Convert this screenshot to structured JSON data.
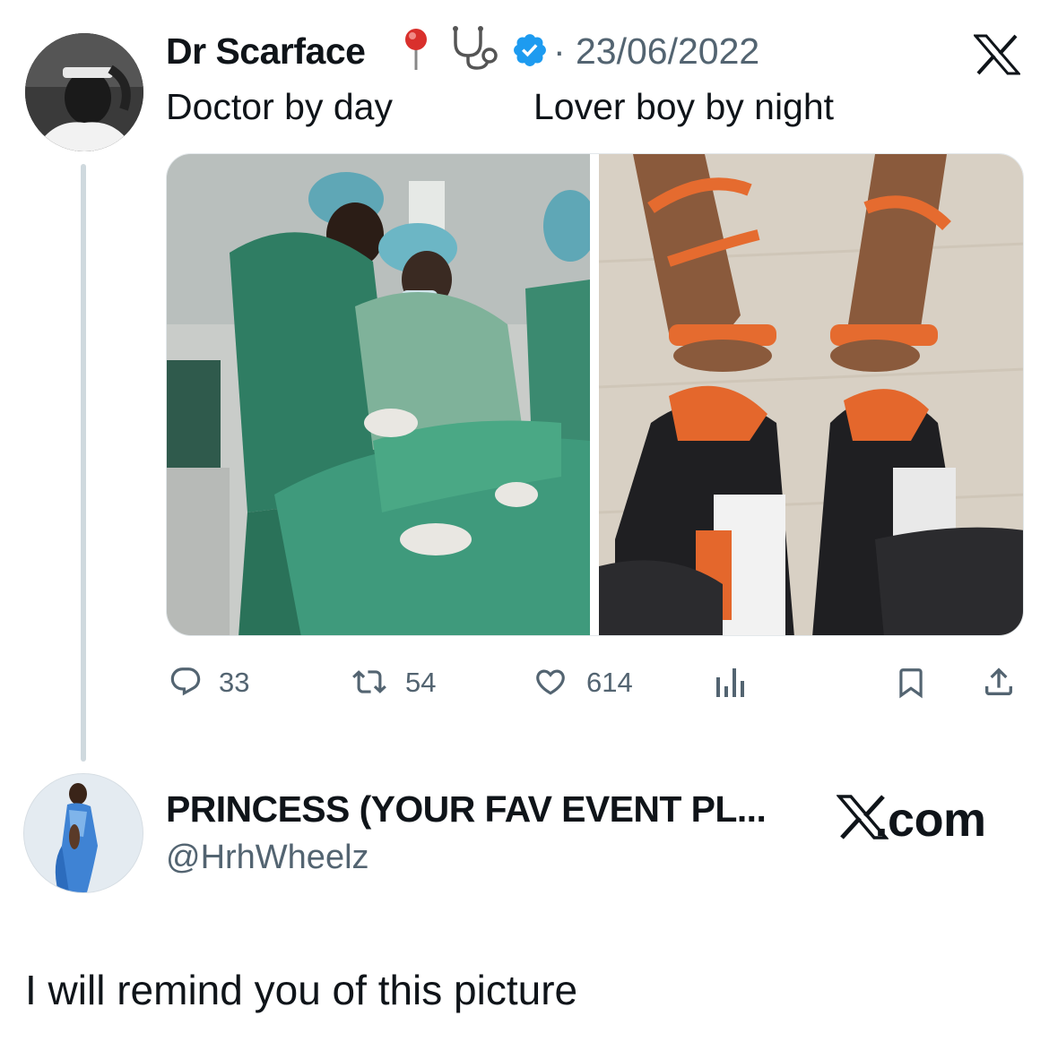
{
  "tweet": {
    "author_name": "Dr Scarface",
    "name_emojis": [
      "round-pushpin-icon",
      "stethoscope-icon"
    ],
    "verified": true,
    "separator": "·",
    "date": "23/06/2022",
    "text_left": "Doctor by day",
    "text_right": "Lover boy by night",
    "media": [
      {
        "description_icon": "surgeons-operating-photo"
      },
      {
        "description_icon": "heels-and-sneakers-photo"
      }
    ],
    "actions": {
      "replies": "33",
      "retweets": "54",
      "likes": "614"
    }
  },
  "reply": {
    "author_name": "PRINCESS (YOUR FAV EVENT PL...",
    "handle": "@HrhWheelz",
    "brand": "X.com",
    "text": "I will remind you of this picture"
  },
  "colors": {
    "text": "#0f1419",
    "secondary": "#536471",
    "verified_blue": "#1d9bf0",
    "thread_line": "#cfd9de"
  }
}
